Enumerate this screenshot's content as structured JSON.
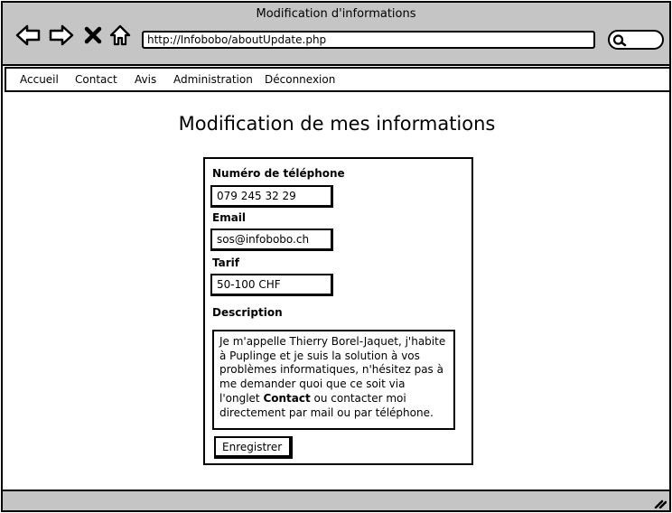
{
  "window": {
    "title": "Modification d'informations"
  },
  "browser": {
    "url": "http://Infobobo/aboutUpdate.php",
    "icons": [
      "back-arrow-icon",
      "forward-arrow-icon",
      "close-x-icon",
      "home-icon",
      "search-icon"
    ]
  },
  "nav": {
    "items": [
      {
        "label": "Accueil"
      },
      {
        "label": "Contact"
      },
      {
        "label": "Avis"
      },
      {
        "label": "Administration"
      },
      {
        "label": "Déconnexion"
      }
    ]
  },
  "page": {
    "title": "Modification de mes informations"
  },
  "form": {
    "phone": {
      "label": "Numéro de téléphone",
      "value": "079 245 32 29"
    },
    "email": {
      "label": "Email",
      "value": "sos@infobobo.ch"
    },
    "tarif": {
      "label": "Tarif",
      "value": "50-100 CHF"
    },
    "description": {
      "label": "Description",
      "text_before": "Je m'appelle Thierry Borel-Jaquet, j'habite à Puplinge et je suis la solution à vos problèmes informatiques, n'hésitez pas à me demander quoi que ce soit via l'onglet ",
      "bold": "Contact",
      "text_after": " ou contacter moi directement par mail ou par téléphone."
    },
    "submit_label": "Enregistrer"
  },
  "colors": {
    "chrome": "#c5c5c5",
    "border": "#000000",
    "background": "#ffffff"
  }
}
